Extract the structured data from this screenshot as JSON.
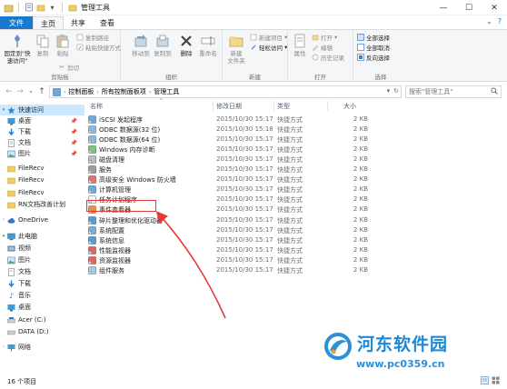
{
  "window": {
    "title": "管理工具",
    "controls": {
      "minimize": "—",
      "maximize": "☐",
      "close": "✕"
    }
  },
  "ribbon": {
    "tabs": [
      {
        "label": "文件"
      },
      {
        "label": "主页"
      },
      {
        "label": "共享"
      },
      {
        "label": "查看"
      }
    ],
    "clipboard": {
      "pin_label": "固定到\"快\n速访问\"",
      "copy_label": "复制",
      "paste_label": "粘贴",
      "copy_path_label": "复制路径",
      "paste_shortcut_label": "粘贴快捷方式",
      "cut_label": "剪切",
      "group_label": "剪贴板"
    },
    "organize": {
      "move_label": "移动到",
      "copyto_label": "复制到",
      "delete_label": "删除",
      "rename_label": "重命名",
      "group_label": "组织"
    },
    "new": {
      "newfolder_label": "新建\n文件夹",
      "newitem_label": "新建项目",
      "easyaccess_label": "轻松访问",
      "group_label": "新建"
    },
    "open": {
      "properties_label": "属性",
      "open_label": "打开",
      "edit_label": "编辑",
      "history_label": "历史记录",
      "group_label": "打开"
    },
    "select": {
      "select_all_label": "全部选择",
      "select_none_label": "全部取消",
      "invert_label": "反向选择",
      "group_label": "选择"
    }
  },
  "address": {
    "segments": [
      "控制面板",
      "所有控制面板项",
      "管理工具"
    ],
    "search_placeholder": "搜索\"管理工具\""
  },
  "columns": {
    "name": "名称",
    "date": "修改日期",
    "type": "类型",
    "size": "大小"
  },
  "files": [
    {
      "name": "iSCSI 发起程序",
      "date": "2015/10/30 15:17",
      "type": "快捷方式",
      "size": "2 KB",
      "icon": "iscsi-icon"
    },
    {
      "name": "ODBC 数据源(32 位)",
      "date": "2015/10/30 15:18",
      "type": "快捷方式",
      "size": "2 KB",
      "icon": "odbc-icon"
    },
    {
      "name": "ODBC 数据源(64 位)",
      "date": "2015/10/30 15:17",
      "type": "快捷方式",
      "size": "2 KB",
      "icon": "odbc-icon"
    },
    {
      "name": "Windows 内存诊断",
      "date": "2015/10/30 15:17",
      "type": "快捷方式",
      "size": "2 KB",
      "icon": "memory-icon"
    },
    {
      "name": "磁盘清理",
      "date": "2015/10/30 15:17",
      "type": "快捷方式",
      "size": "2 KB",
      "icon": "disk-cleanup-icon"
    },
    {
      "name": "服务",
      "date": "2015/10/30 15:17",
      "type": "快捷方式",
      "size": "2 KB",
      "icon": "services-icon"
    },
    {
      "name": "高级安全 Windows 防火墙",
      "date": "2015/10/30 15:17",
      "type": "快捷方式",
      "size": "2 KB",
      "icon": "firewall-icon"
    },
    {
      "name": "计算机管理",
      "date": "2015/10/30 15:17",
      "type": "快捷方式",
      "size": "2 KB",
      "icon": "computer-mgmt-icon"
    },
    {
      "name": "任务计划程序",
      "date": "2015/10/30 15:17",
      "type": "快捷方式",
      "size": "2 KB",
      "icon": "task-scheduler-icon"
    },
    {
      "name": "事件查看器",
      "date": "2015/10/30 15:17",
      "type": "快捷方式",
      "size": "2 KB",
      "icon": "event-viewer-icon"
    },
    {
      "name": "碎片整理和优化驱动器",
      "date": "2015/10/30 15:17",
      "type": "快捷方式",
      "size": "2 KB",
      "icon": "defrag-icon"
    },
    {
      "name": "系统配置",
      "date": "2015/10/30 15:17",
      "type": "快捷方式",
      "size": "2 KB",
      "icon": "msconfig-icon"
    },
    {
      "name": "系统信息",
      "date": "2015/10/30 15:17",
      "type": "快捷方式",
      "size": "2 KB",
      "icon": "sysinfo-icon"
    },
    {
      "name": "性能监视器",
      "date": "2015/10/30 15:17",
      "type": "快捷方式",
      "size": "2 KB",
      "icon": "perfmon-icon"
    },
    {
      "name": "资源监视器",
      "date": "2015/10/30 15:17",
      "type": "快捷方式",
      "size": "2 KB",
      "icon": "resmon-icon"
    },
    {
      "name": "组件服务",
      "date": "2015/10/30 15:17",
      "type": "快捷方式",
      "size": "2 KB",
      "icon": "component-services-icon"
    }
  ],
  "nav": {
    "quick_access": "快速访问",
    "desktop": "桌面",
    "downloads": "下载",
    "documents": "文档",
    "pictures": "图片",
    "filerecv1": "FileRecv",
    "filerecv2": "FileRecv",
    "filerecv3": "FileRecv",
    "rn": "RN文档改善计划",
    "onedrive": "OneDrive",
    "thispc": "此电脑",
    "videos": "视频",
    "pictures2": "图片",
    "documents2": "文档",
    "downloads2": "下载",
    "music": "音乐",
    "desktop2": "桌面",
    "drive_c": "Acer (C:)",
    "drive_d": "DATA (D:)",
    "network": "网络"
  },
  "status": {
    "count": "16 个项目"
  },
  "watermark": {
    "text": "河东软件园",
    "url": "www.pc0359.cn"
  },
  "colors": {
    "accent": "#1979ca",
    "selection": "#cce8ff",
    "highlight_box": "#e53935",
    "watermark": "#1e88d6"
  }
}
